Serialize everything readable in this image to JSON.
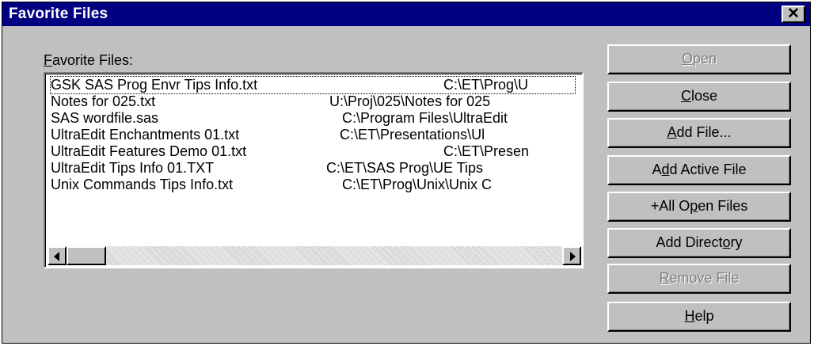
{
  "window": {
    "title": "Favorite Files",
    "close_glyph": "✕"
  },
  "list": {
    "label_prefix": "F",
    "label_rest": "avorite Files:",
    "rows": [
      {
        "name": "GSK SAS Prog Envr Tips Info.txt",
        "path": "C:\\ET\\Prog\\U"
      },
      {
        "name": "Notes for 025.txt",
        "path": "U:\\Proj\\025\\Notes for 025"
      },
      {
        "name": "SAS wordfile.sas",
        "path": "C:\\Program Files\\UltraEdit"
      },
      {
        "name": "UltraEdit Enchantments 01.txt",
        "path": "C:\\ET\\Presentations\\Ul"
      },
      {
        "name": "UltraEdit Features Demo 01.txt",
        "path": "C:\\ET\\Presen"
      },
      {
        "name": "UltraEdit Tips Info 01.TXT",
        "path": "C:\\ET\\SAS Prog\\UE Tips"
      },
      {
        "name": "Unix Commands Tips Info.txt",
        "path": "C:\\ET\\Prog\\Unix\\Unix C"
      }
    ]
  },
  "buttons": {
    "open": {
      "pre": "",
      "key": "O",
      "post": "pen",
      "enabled": false
    },
    "close": {
      "pre": "",
      "key": "C",
      "post": "lose",
      "enabled": true
    },
    "add_file": {
      "pre": "",
      "key": "A",
      "post": "dd File...",
      "enabled": true
    },
    "add_active": {
      "pre": "A",
      "key": "d",
      "post": "d Active File",
      "enabled": true
    },
    "all_open": {
      "pre": "+All O",
      "key": "p",
      "post": "en Files",
      "enabled": true
    },
    "add_dir": {
      "pre": "Add Direct",
      "key": "o",
      "post": "ry",
      "enabled": true
    },
    "remove": {
      "pre": "",
      "key": "R",
      "post": "emove File",
      "enabled": false
    },
    "help": {
      "pre": "",
      "key": "H",
      "post": "elp",
      "enabled": true
    }
  },
  "colors": {
    "titlebar": "#000080",
    "face": "#c0c0c0",
    "disabled_text": "#808080"
  }
}
